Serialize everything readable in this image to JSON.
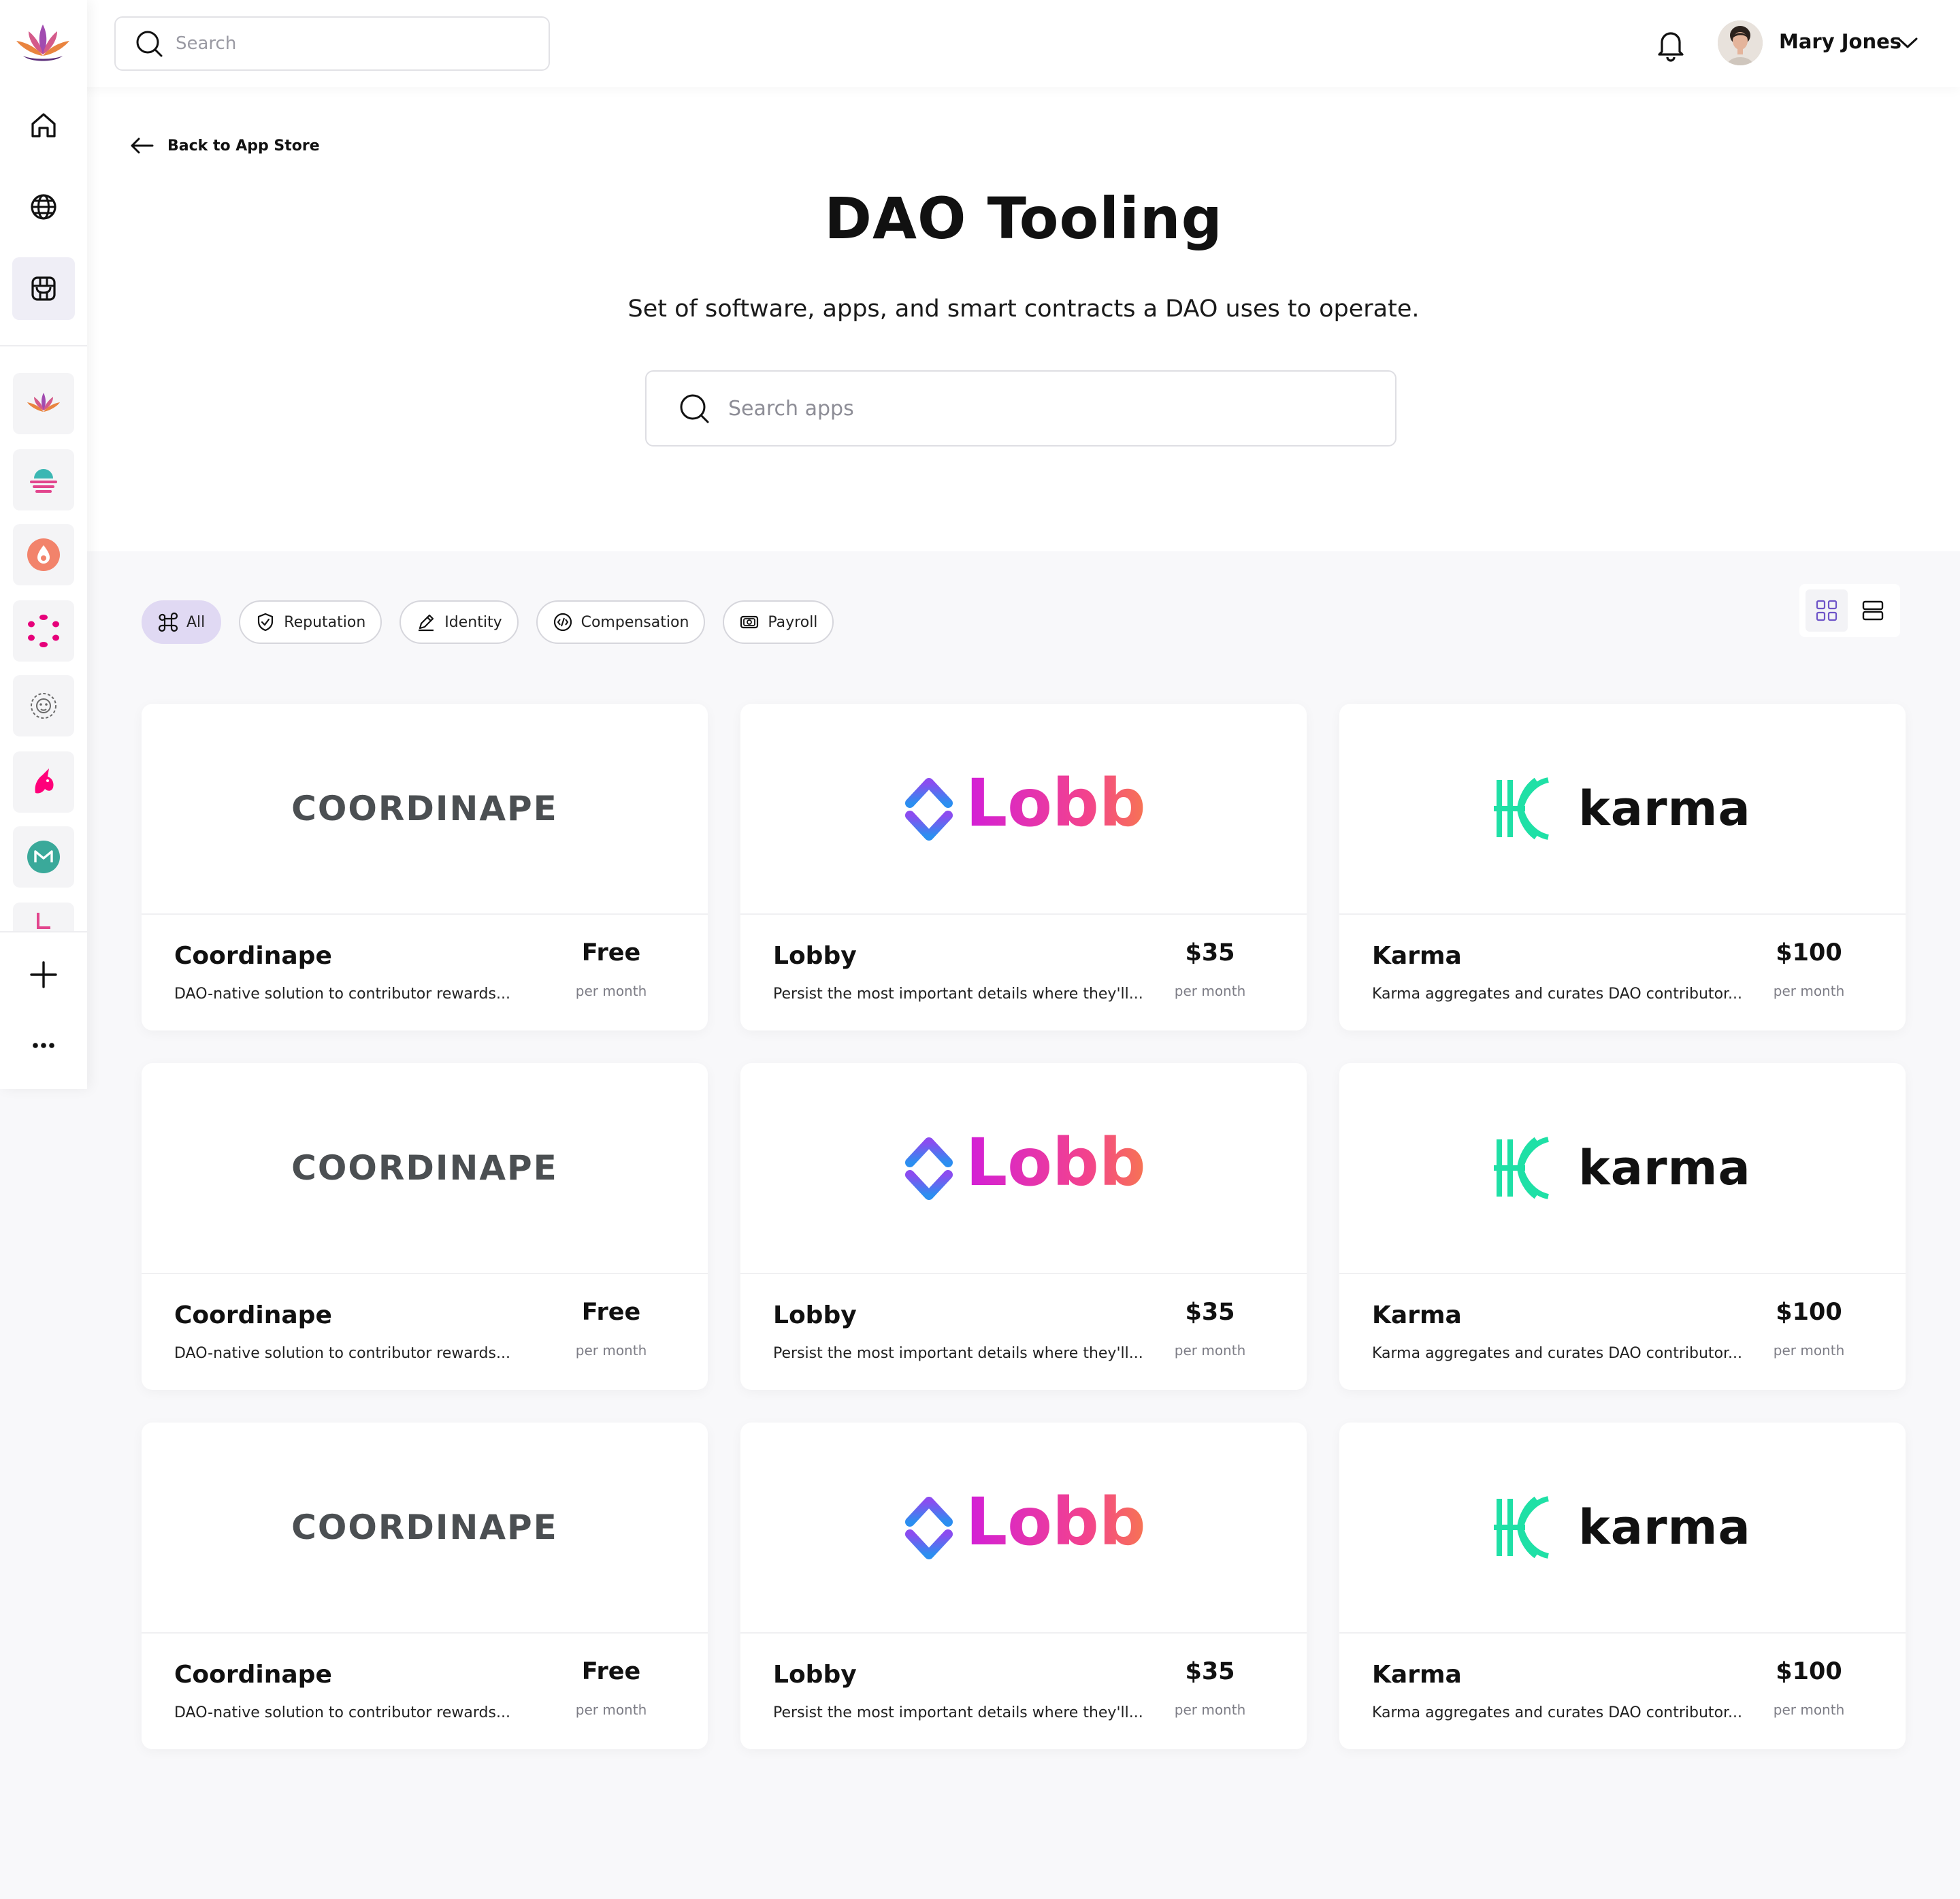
{
  "header": {
    "search_placeholder": "Search",
    "user_name": "Mary Jones"
  },
  "sidebar": {
    "nav": [
      "home-icon",
      "globe-icon",
      "app-store-icon"
    ],
    "apps": [
      "lotus-app-icon",
      "sunset-app-icon",
      "drop-app-icon",
      "ring-app-icon",
      "lion-app-icon",
      "unicorn-app-icon",
      "m-app-icon",
      "l-app-icon"
    ],
    "bottom": [
      "plus-icon",
      "more-icon"
    ]
  },
  "main": {
    "back_label": "Back to App Store",
    "title": "DAO Tooling",
    "subtitle": "Set of software, apps, and smart contracts a DAO uses to operate.",
    "search_placeholder": "Search apps"
  },
  "filters": [
    {
      "label": "All",
      "icon": "command-icon",
      "active": true
    },
    {
      "label": "Reputation",
      "icon": "shield-check-icon",
      "active": false
    },
    {
      "label": "Identity",
      "icon": "pen-icon",
      "active": false
    },
    {
      "label": "Compensation",
      "icon": "coin-icon",
      "active": false
    },
    {
      "label": "Payroll",
      "icon": "banknote-icon",
      "active": false
    }
  ],
  "view_toggle": {
    "selected": "grid",
    "options": [
      "grid-icon",
      "list-icon"
    ]
  },
  "brand": {
    "purple": "#e0d9f3",
    "karma_green": "#1fe0a6",
    "coordinape_gray": "#4b4f52"
  },
  "logo_text": {
    "coordinape": "COORDINAPE",
    "lobby": "Lobby",
    "karma": "karma"
  },
  "cards": [
    {
      "logo": "coordinape",
      "name": "Coordinape",
      "desc": "DAO-native solution to contributor rewards...",
      "price": "Free",
      "period": "per month"
    },
    {
      "logo": "lobby",
      "name": "Lobby",
      "desc": "Persist the most important details where they'll...",
      "price": "$35",
      "period": "per month"
    },
    {
      "logo": "karma",
      "name": "Karma",
      "desc": "Karma aggregates and curates DAO contributor...",
      "price": "$100",
      "period": "per month"
    },
    {
      "logo": "coordinape",
      "name": "Coordinape",
      "desc": "DAO-native solution to contributor rewards...",
      "price": "Free",
      "period": "per month"
    },
    {
      "logo": "lobby",
      "name": "Lobby",
      "desc": "Persist the most important details where they'll...",
      "price": "$35",
      "period": "per month"
    },
    {
      "logo": "karma",
      "name": "Karma",
      "desc": "Karma aggregates and curates DAO contributor...",
      "price": "$100",
      "period": "per month"
    },
    {
      "logo": "coordinape",
      "name": "Coordinape",
      "desc": "DAO-native solution to contributor rewards...",
      "price": "Free",
      "period": "per month"
    },
    {
      "logo": "lobby",
      "name": "Lobby",
      "desc": "Persist the most important details where they'll...",
      "price": "$35",
      "period": "per month"
    },
    {
      "logo": "karma",
      "name": "Karma",
      "desc": "Karma aggregates and curates DAO contributor...",
      "price": "$100",
      "period": "per month"
    }
  ]
}
